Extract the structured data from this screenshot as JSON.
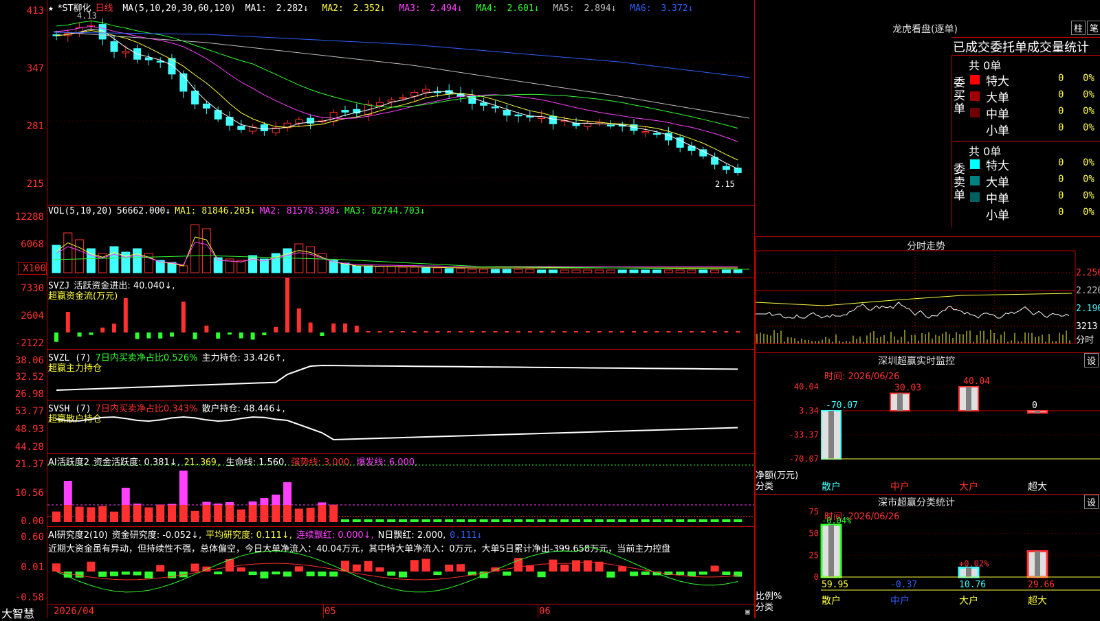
{
  "stock": {
    "name": "*ST柳化",
    "period": "日线",
    "star": "★",
    "top_note": "4.13",
    "low_note": "2.15"
  },
  "main_chart": {
    "y_ticks": [
      "413",
      "347",
      "281",
      "215"
    ],
    "ma_label": "MA(5,10,20,30,60,120)",
    "ma": [
      {
        "label": "MA1:",
        "value": "2.282↓",
        "color": "#ffffff"
      },
      {
        "label": "MA2:",
        "value": "2.352↓",
        "color": "#ffff40"
      },
      {
        "label": "MA3:",
        "value": "2.494↓",
        "color": "#ff40ff"
      },
      {
        "label": "MA4:",
        "value": "2.601↓",
        "color": "#30ff30"
      },
      {
        "label": "MA5:",
        "value": "2.894↓",
        "color": "#c0c0c0"
      },
      {
        "label": "MA6:",
        "value": "3.372↓",
        "color": "#3060ff"
      }
    ]
  },
  "vol_panel": {
    "y_ticks": [
      "12288",
      "6068",
      "X100"
    ],
    "label": "VOL(5,10,20)",
    "value": "56662.000↓",
    "ma1": "MA1: 81846.203↓",
    "ma2": "MA2: 81578.398↓",
    "ma3": "MA3: 82744.703↓"
  },
  "svzj_panel": {
    "y_ticks": [
      "7330",
      "2604",
      "-2122"
    ],
    "label": "SVZJ",
    "text": "活跃资金进出: 40.040↓,",
    "title": "超赢资金流(万元)"
  },
  "svzl_panel": {
    "y_ticks": [
      "38.06",
      "32.52",
      "26.98"
    ],
    "label": "SVZL (7)",
    "ratio": "7日内买卖净占比0.526%",
    "hold": "主力持仓: 33.426↑,",
    "title": "超赢主力持仓"
  },
  "svsh_panel": {
    "y_ticks": [
      "53.77",
      "48.93",
      "44.28"
    ],
    "label": "SVSH (7)",
    "ratio": "7日内买卖净占比0.343%",
    "hold": "散户持仓: 48.446↓,",
    "title": "超赢散户持仓"
  },
  "ai_active_panel": {
    "y_ticks": [
      "21.37",
      "10.56",
      "0.00"
    ],
    "label": "AI活跃度2",
    "a": "资金活跃度: 0.381↓,",
    "b": "21.369,",
    "c": "生命线: 1.560,",
    "d": "强势线: 3.000,",
    "e": "爆发线: 6.000,"
  },
  "ai_research_panel": {
    "y_ticks": [
      "0.60",
      "0.01",
      "-0.58"
    ],
    "label": "AI研究度2(10)",
    "a": "资金研究度: -0.052↓,",
    "b": "平均研究度: 0.111↓,",
    "c": "连续飘红: 0.000↓,",
    "d": "N日飘红: 2.000,",
    "e": "0.111↓",
    "comment": "近期大资金虽有异动，但持续性不强，总体偏空，今日大单净流入：40.04万元，其中特大单净流入：0万元，大单5日累计净出-399.658万元，当前主力控盘"
  },
  "x_axis": {
    "d1": "2026/04",
    "d2": "05",
    "d3": "06",
    "logo": "大智慧"
  },
  "lhb": {
    "title": "龙虎看盘(逐单)",
    "btn1": "柱",
    "btn2": "笔",
    "sub": "已成交委托单成交量统计",
    "buy_label": "委买单",
    "sell_label": "委卖单",
    "buy": {
      "total": "共 0单",
      "rows": [
        {
          "name": "特大",
          "n": "0",
          "p": "0%",
          "color": "#ff0000"
        },
        {
          "name": "大单",
          "n": "0",
          "p": "0%",
          "color": "#a00000"
        },
        {
          "name": "中单",
          "n": "0",
          "p": "0%",
          "color": "#700000"
        },
        {
          "name": "小单",
          "n": "0",
          "p": "0%",
          "color": "#000000"
        }
      ]
    },
    "sell": {
      "total": "共 0单",
      "rows": [
        {
          "name": "特大",
          "n": "0",
          "p": "0%",
          "color": "#00ffff"
        },
        {
          "name": "大单",
          "n": "0",
          "p": "0%",
          "color": "#008080"
        },
        {
          "name": "中单",
          "n": "0",
          "p": "0%",
          "color": "#006060"
        },
        {
          "name": "小单",
          "n": "0",
          "p": "0%",
          "color": "#000000"
        }
      ]
    }
  },
  "intraday": {
    "title": "分时走势",
    "p1": "2.250",
    "p2": "2.220",
    "p3": "2.190",
    "vol": "3213",
    "vol_label": "分时"
  },
  "monitor": {
    "title": "深圳超赢实时监控",
    "btn": "设",
    "time": "时间: 2026/06/26",
    "y_ticks": [
      "40.04",
      "3.34",
      "-33.37",
      "-70.07"
    ],
    "unit": "净额(万元)",
    "cat_label": "分类",
    "categories": [
      "散户",
      "中户",
      "大户",
      "超大"
    ],
    "values": [
      -70.07,
      30.03,
      40.04,
      0
    ],
    "value_labels": [
      "-70.07",
      "30.03",
      "40.04",
      "0"
    ]
  },
  "classify": {
    "title": "深市超赢分类统计",
    "btn": "设",
    "time": "时间: 2026/06/26",
    "y_ticks": [
      "75",
      "50",
      "25",
      "0"
    ],
    "unit": "比例%",
    "cat_label": "分类",
    "categories": [
      "散户",
      "中户",
      "大户",
      "超大"
    ],
    "values": [
      59.95,
      -0.37,
      10.76,
      29.66
    ],
    "value_labels": [
      "59.95",
      "-0.37",
      "10.76",
      "29.66"
    ],
    "top_labels": [
      "-0.04%",
      "",
      "+0.02%",
      ""
    ]
  },
  "chart_data": [
    {
      "type": "bar",
      "title": "深圳超赢实时监控",
      "ylabel": "净额(万元)",
      "categories": [
        "散户",
        "中户",
        "大户",
        "超大"
      ],
      "values": [
        -70.07,
        30.03,
        40.04,
        0
      ],
      "ylim": [
        -70.07,
        40.04
      ]
    },
    {
      "type": "bar",
      "title": "深市超赢分类统计",
      "ylabel": "比例%",
      "categories": [
        "散户",
        "中户",
        "大户",
        "超大"
      ],
      "values": [
        59.95,
        -0.37,
        10.76,
        29.66
      ],
      "ylim": [
        0,
        75
      ]
    }
  ]
}
